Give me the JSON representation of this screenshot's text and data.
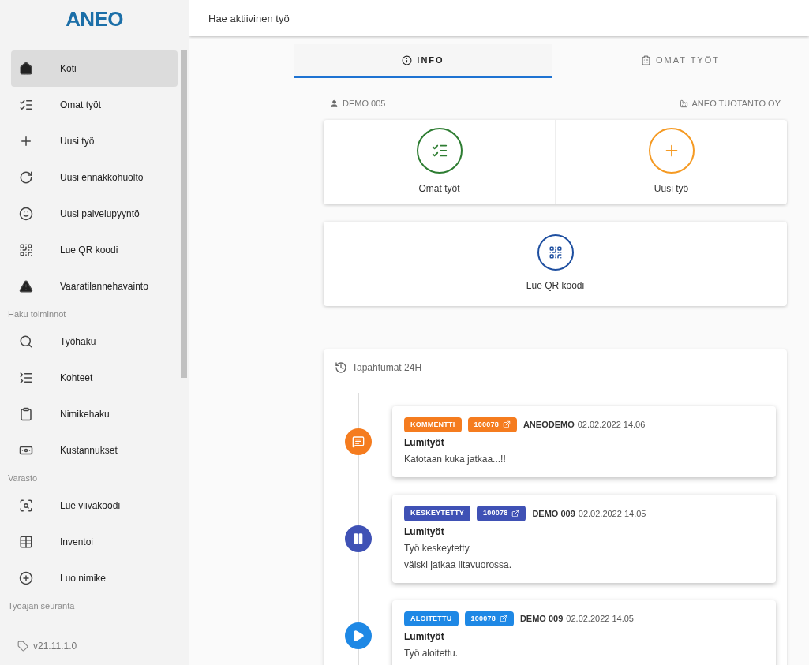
{
  "logo": "ANEO",
  "sidebar": {
    "items": [
      {
        "kind": "item",
        "label": "Koti",
        "selected": true
      },
      {
        "kind": "item",
        "label": "Omat työt",
        "selected": false
      },
      {
        "kind": "item",
        "label": "Uusi työ",
        "selected": false
      },
      {
        "kind": "item",
        "label": "Uusi ennakkohuolto",
        "selected": false
      },
      {
        "kind": "item",
        "label": "Uusi palvelupyyntö",
        "selected": false
      },
      {
        "kind": "item",
        "label": "Lue QR koodi",
        "selected": false
      },
      {
        "kind": "item",
        "label": "Vaaratilannehavainto",
        "selected": false
      },
      {
        "kind": "section",
        "label": "Haku toiminnot"
      },
      {
        "kind": "item",
        "label": "Työhaku",
        "selected": false
      },
      {
        "kind": "item",
        "label": "Kohteet",
        "selected": false
      },
      {
        "kind": "item",
        "label": "Nimikehaku",
        "selected": false
      },
      {
        "kind": "item",
        "label": "Kustannukset",
        "selected": false
      },
      {
        "kind": "section",
        "label": "Varasto"
      },
      {
        "kind": "item",
        "label": "Lue viivakoodi",
        "selected": false
      },
      {
        "kind": "item",
        "label": "Inventoi",
        "selected": false
      },
      {
        "kind": "item",
        "label": "Luo nimike",
        "selected": false
      },
      {
        "kind": "section",
        "label": "Työajan seuranta"
      }
    ],
    "version": "v21.11.1.0"
  },
  "search": {
    "placeholder": "Hae aktiivinen työ"
  },
  "tabs": [
    {
      "label": "INFO",
      "selected": true
    },
    {
      "label": "OMAT TYÖT",
      "selected": false
    }
  ],
  "user": "DEMO 005",
  "company": "ANEO TUOTANTO OY",
  "actions": [
    {
      "label": "Omat työt",
      "color": "#2e7d32"
    },
    {
      "label": "Uusi työ",
      "color": "#f59a23"
    }
  ],
  "qr_action": {
    "label": "Lue QR koodi",
    "color": "#1e4fa0"
  },
  "events": {
    "title": "Tapahtumat 24H",
    "items": [
      {
        "kind": "comment",
        "color": "#f57c1f",
        "status": "KOMMENTTI",
        "number": "100078",
        "user": "ANEODEMO",
        "time": "02.02.2022 14.06",
        "title": "Lumityöt",
        "lines": [
          "Katotaan kuka jatkaa...!!"
        ]
      },
      {
        "kind": "paused",
        "color": "#3f51b5",
        "status": "KESKEYTETTY",
        "number": "100078",
        "user": "DEMO 009",
        "time": "02.02.2022 14.05",
        "title": "Lumityöt",
        "lines": [
          "Työ keskeytetty.",
          "väiski jatkaa iltavuorossa."
        ]
      },
      {
        "kind": "started",
        "color": "#1e88e5",
        "status": "ALOITETTU",
        "number": "100078",
        "user": "DEMO 009",
        "time": "02.02.2022 14.05",
        "title": "Lumityöt",
        "lines": [
          "Työ aloitettu."
        ]
      }
    ]
  }
}
